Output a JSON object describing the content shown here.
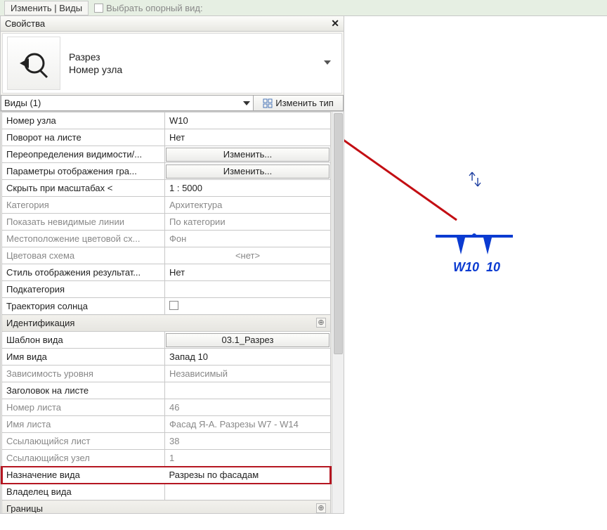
{
  "ribbon": {
    "tab_label": "Изменить | Виды",
    "secondary_label": "Выбрать опорный вид:"
  },
  "panel": {
    "title": "Свойства",
    "type_line1": "Разрез",
    "type_line2": "Номер узла",
    "selector_text": "Виды (1)",
    "edit_type_label": "Изменить тип"
  },
  "props": {
    "group_ident": "Идентификация",
    "group_bounds": "Границы",
    "rows": {
      "node_num": {
        "lbl": "Номер узла",
        "val": "W10"
      },
      "rotation": {
        "lbl": "Поворот на листе",
        "val": "Нет"
      },
      "visib_over": {
        "lbl": "Переопределения видимости/...",
        "btn": "Изменить..."
      },
      "display_params": {
        "lbl": "Параметры отображения гра...",
        "btn": "Изменить..."
      },
      "hide_scale": {
        "lbl": "Скрыть при масштабах <",
        "val": "1 : 5000"
      },
      "category": {
        "lbl": "Категория",
        "val": "Архитектура"
      },
      "hidden_lines": {
        "lbl": "Показать невидимые линии",
        "val": "По категории"
      },
      "color_scheme_loc": {
        "lbl": "Местоположение цветовой сх...",
        "val": "Фон"
      },
      "color_scheme": {
        "lbl": "Цветовая схема",
        "val": "<нет>"
      },
      "result_style": {
        "lbl": "Стиль отображения результат...",
        "val": "Нет"
      },
      "subcategory": {
        "lbl": "Подкатегория",
        "val": ""
      },
      "sun_path": {
        "lbl": "Траектория солнца",
        "val": ""
      },
      "view_template": {
        "lbl": "Шаблон вида",
        "btn": "03.1_Разрез"
      },
      "view_name": {
        "lbl": "Имя вида",
        "val": "Запад 10"
      },
      "level_dep": {
        "lbl": "Зависимость уровня",
        "val": "Независимый"
      },
      "sheet_title": {
        "lbl": "Заголовок на листе",
        "val": ""
      },
      "sheet_num": {
        "lbl": "Номер листа",
        "val": "46"
      },
      "sheet_name": {
        "lbl": "Имя листа",
        "val": "Фасад Я-А. Разрезы W7 - W14"
      },
      "ref_sheet": {
        "lbl": "Ссылающийся лист",
        "val": "38"
      },
      "ref_node": {
        "lbl": "Ссылающийся узел",
        "val": "1"
      },
      "view_purpose": {
        "lbl": "Назначение вида",
        "val": "Разрезы по фасадам"
      },
      "view_owner": {
        "lbl": "Владелец вида",
        "val": ""
      }
    }
  },
  "canvas": {
    "marker_label_left": "W10",
    "marker_label_right": "10"
  }
}
